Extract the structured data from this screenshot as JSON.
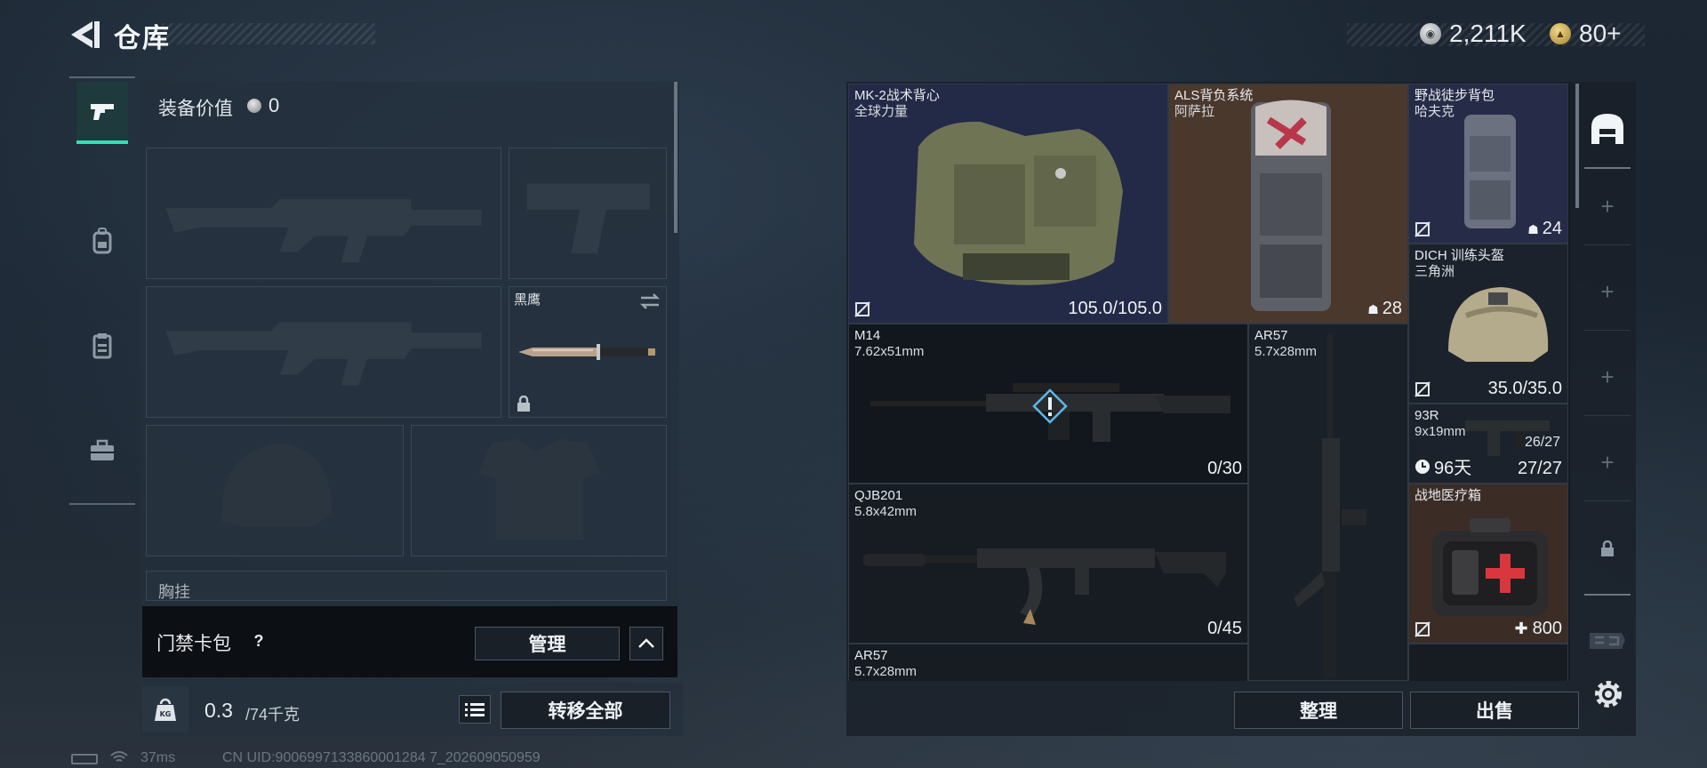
{
  "header": {
    "title": "仓库",
    "currency_silver": "2,211K",
    "currency_gold": "80+"
  },
  "left_rail": {
    "tabs": [
      {
        "name": "weapons",
        "icon": "pistol-icon",
        "active": true
      },
      {
        "name": "backpack",
        "icon": "backpack-icon",
        "active": false
      },
      {
        "name": "vest",
        "icon": "clipboard-icon",
        "active": false
      },
      {
        "name": "case",
        "icon": "toolbox-icon",
        "active": false
      }
    ]
  },
  "loadout": {
    "equip_value_label": "装备价值",
    "equip_value": "0",
    "knife_name": "黑鹰",
    "partial_section": "胸挂",
    "access_card_label": "门禁卡包",
    "help": "?",
    "manage_label": "管理",
    "weight_value": "0.3",
    "weight_capacity": "/74千克",
    "transfer_all_label": "转移全部"
  },
  "status": {
    "ping": "37ms",
    "uid": "CN UID:9006997133860001284 7_202609050959"
  },
  "inventory": {
    "items": [
      {
        "key": "vest",
        "name": "MK-2战术背心",
        "sub": "全球力量",
        "value": "105.0/105.0"
      },
      {
        "key": "als",
        "name": "ALS背负系统",
        "sub": "阿萨拉",
        "value": "28"
      },
      {
        "key": "pack",
        "name": "野战徒步背包",
        "sub": "哈夫克",
        "value": "24"
      },
      {
        "key": "helmet",
        "name": "DICH 训练头盔",
        "sub": "三角洲",
        "value": "35.0/35.0"
      },
      {
        "key": "m14",
        "name": "M14",
        "sub": "7.62x51mm",
        "value": "0/30"
      },
      {
        "key": "ar57a",
        "name": "AR57",
        "sub": "5.7x28mm",
        "value": ""
      },
      {
        "key": "93r",
        "name": "93R",
        "sub": "9x19mm",
        "value": "27/27",
        "extra": "26/27",
        "timer": "96天"
      },
      {
        "key": "qjb",
        "name": "QJB201",
        "sub": "5.8x42mm",
        "value": "0/45"
      },
      {
        "key": "medkit",
        "name": "战地医疗箱",
        "sub": "",
        "value": "800"
      },
      {
        "key": "ar57b",
        "name": "AR57",
        "sub": "5.7x28mm",
        "value": ""
      }
    ],
    "sort_label": "整理",
    "sell_label": "出售"
  },
  "colors": {
    "accent": "#2ee1b4",
    "vest_bg": "#232a47",
    "als_bg": "#4a382c",
    "pack_bg": "#262c48",
    "medkit_bg": "#3b2d26"
  }
}
